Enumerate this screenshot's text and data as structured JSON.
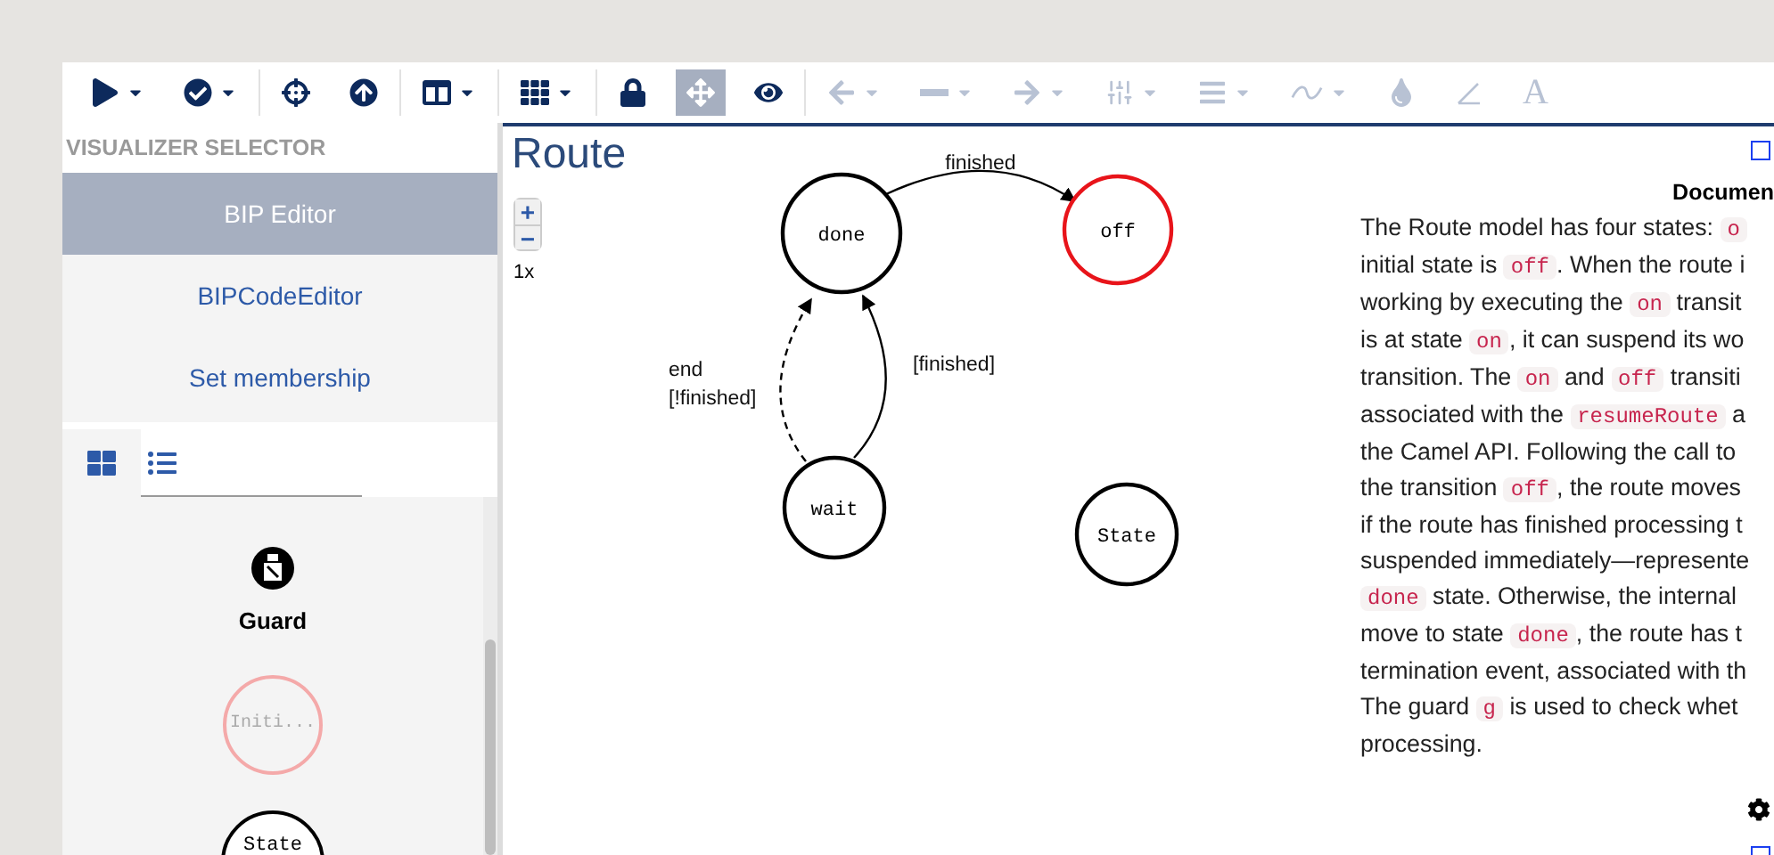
{
  "toolbar": {
    "groups": [
      [
        {
          "kind": "play",
          "dropdown": true,
          "selected": false,
          "disabled": false
        },
        {
          "kind": "check",
          "dropdown": true,
          "selected": false,
          "disabled": false
        }
      ],
      [
        {
          "kind": "crosshair",
          "dropdown": false,
          "selected": false,
          "disabled": false
        },
        {
          "kind": "upload",
          "dropdown": false,
          "selected": false,
          "disabled": false
        }
      ],
      [
        {
          "kind": "columns",
          "dropdown": true,
          "selected": false,
          "disabled": false
        }
      ],
      [
        {
          "kind": "grid",
          "dropdown": true,
          "selected": false,
          "disabled": false
        }
      ],
      [
        {
          "kind": "lock",
          "dropdown": false,
          "selected": false,
          "disabled": false
        },
        {
          "kind": "move",
          "dropdown": false,
          "selected": true,
          "disabled": false
        },
        {
          "kind": "eye",
          "dropdown": false,
          "selected": false,
          "disabled": false
        }
      ],
      [
        {
          "kind": "arrow-left",
          "dropdown": true,
          "selected": false,
          "disabled": true
        },
        {
          "kind": "line",
          "dropdown": true,
          "selected": false,
          "disabled": true
        },
        {
          "kind": "arrow-right",
          "dropdown": true,
          "selected": false,
          "disabled": true
        },
        {
          "kind": "sliders",
          "dropdown": true,
          "selected": false,
          "disabled": true
        },
        {
          "kind": "bars",
          "dropdown": true,
          "selected": false,
          "disabled": true
        },
        {
          "kind": "wave",
          "dropdown": true,
          "selected": false,
          "disabled": true
        },
        {
          "kind": "drop",
          "dropdown": false,
          "selected": false,
          "disabled": true
        },
        {
          "kind": "pen",
          "dropdown": false,
          "selected": false,
          "disabled": true
        },
        {
          "kind": "letter",
          "glyph": "A",
          "dropdown": false,
          "selected": false,
          "disabled": true
        }
      ]
    ]
  },
  "sidebar": {
    "title": "VISUALIZER SELECTOR",
    "visualizers": [
      {
        "label": "BIP Editor",
        "selected": true
      },
      {
        "label": "BIPCodeEditor",
        "selected": false
      },
      {
        "label": "Set membership",
        "selected": false
      }
    ],
    "view_tabs": [
      {
        "kind": "grid",
        "selected": true
      },
      {
        "kind": "list",
        "selected": false
      }
    ],
    "palette": [
      {
        "kind": "guard",
        "label": "Guard"
      },
      {
        "kind": "initial",
        "label": "Initi..."
      },
      {
        "kind": "state",
        "label": "State"
      }
    ]
  },
  "canvas": {
    "title": "Route",
    "zoom_in": "+",
    "zoom_out": "−",
    "zoom": "1x",
    "nodes": [
      {
        "label": "done",
        "active": false
      },
      {
        "label": "off",
        "active": true
      },
      {
        "label": "wait",
        "active": false
      },
      {
        "label": "State",
        "active": false
      }
    ],
    "edges": [
      {
        "label": "finished",
        "dashed": false
      },
      {
        "label": "end\n[!finished]",
        "dashed": true
      },
      {
        "label": "[finished]",
        "dashed": false
      }
    ]
  },
  "documentation": {
    "heading": "Documen",
    "lines": [
      [
        {
          "kind": "text",
          "text": "The Route model has four states: "
        },
        {
          "kind": "code",
          "text": "o"
        }
      ],
      [
        {
          "kind": "text",
          "text": "initial state is "
        },
        {
          "kind": "code",
          "text": "off"
        },
        {
          "kind": "text",
          "text": ". When the route i"
        }
      ],
      [
        {
          "kind": "text",
          "text": "working by executing the "
        },
        {
          "kind": "code",
          "text": "on"
        },
        {
          "kind": "text",
          "text": " transit"
        }
      ],
      [
        {
          "kind": "text",
          "text": "is at state "
        },
        {
          "kind": "code",
          "text": "on"
        },
        {
          "kind": "text",
          "text": ", it can suspend its wo"
        }
      ],
      [
        {
          "kind": "text",
          "text": "transition. The "
        },
        {
          "kind": "code",
          "text": "on"
        },
        {
          "kind": "text",
          "text": " and "
        },
        {
          "kind": "code",
          "text": "off"
        },
        {
          "kind": "text",
          "text": " transiti"
        }
      ],
      [
        {
          "kind": "text",
          "text": "associated with the "
        },
        {
          "kind": "code",
          "text": "resumeRoute"
        },
        {
          "kind": "text",
          "text": " a"
        }
      ],
      [
        {
          "kind": "text",
          "text": "the Camel API. Following the call to"
        }
      ],
      [
        {
          "kind": "text",
          "text": "the transition "
        },
        {
          "kind": "code",
          "text": "off"
        },
        {
          "kind": "text",
          "text": ", the route moves"
        }
      ],
      [
        {
          "kind": "text",
          "text": "if the route has finished processing t"
        }
      ],
      [
        {
          "kind": "text",
          "text": "suspended immediately—represente"
        }
      ],
      [
        {
          "kind": "code",
          "text": "done"
        },
        {
          "kind": "text",
          "text": " state. Otherwise, the internal"
        }
      ],
      [
        {
          "kind": "text",
          "text": "move to state "
        },
        {
          "kind": "code",
          "text": "done"
        },
        {
          "kind": "text",
          "text": ", the route has t"
        }
      ],
      [
        {
          "kind": "text",
          "text": "termination event, associated with th"
        }
      ],
      [
        {
          "kind": "text",
          "text": "The guard "
        },
        {
          "kind": "code",
          "text": "g"
        },
        {
          "kind": "text",
          "text": " is used to check whet"
        }
      ],
      [
        {
          "kind": "text",
          "text": "processing."
        }
      ]
    ]
  }
}
